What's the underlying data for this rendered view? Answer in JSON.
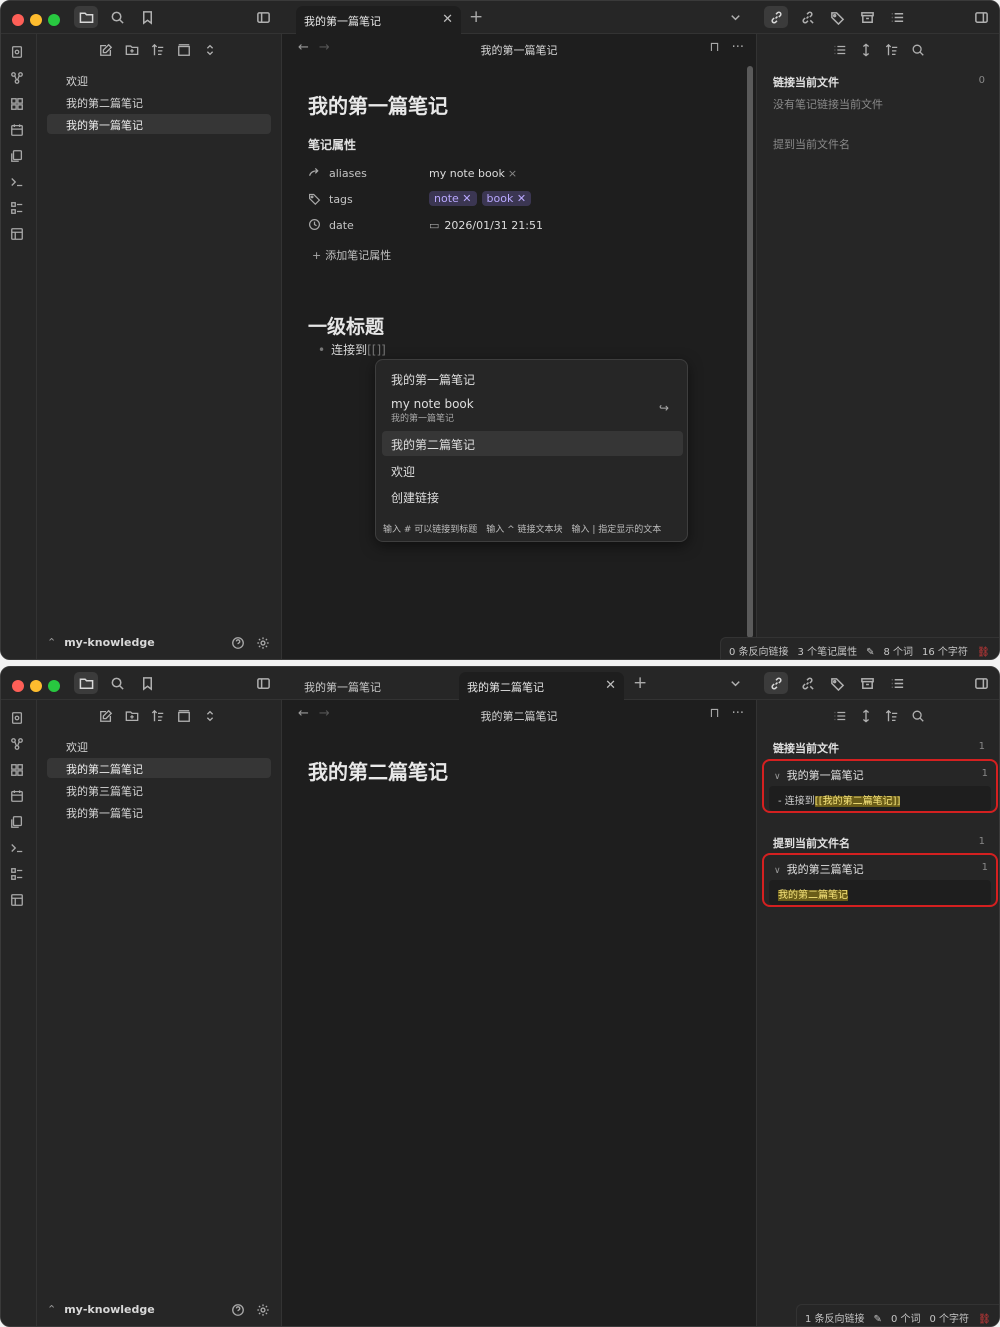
{
  "window1": {
    "tabs": [
      {
        "label": "我的第一篇笔记",
        "active": true
      }
    ],
    "sidebar": {
      "files": [
        "欢迎",
        "我的第二篇笔记",
        "我的第一篇笔记"
      ],
      "selected_index": 2,
      "vault_name": "my-knowledge"
    },
    "view_title": "我的第一篇笔记",
    "note": {
      "title": "我的第一篇笔记",
      "properties_title": "笔记属性",
      "properties": [
        {
          "key": "aliases",
          "icon": "forward-arrow-icon",
          "value": "my note book"
        },
        {
          "key": "tags",
          "icon": "tags-icon",
          "tags": [
            "note",
            "book"
          ]
        },
        {
          "key": "date",
          "icon": "clock-icon",
          "value": "2026/01/31 21:51"
        }
      ],
      "add_property": "添加笔记属性",
      "heading": "一级标题",
      "bullet_text": "连接到",
      "bullet_brackets": "[[]]"
    },
    "suggest": {
      "items": [
        {
          "label": "我的第一篇笔记"
        },
        {
          "label": "my note book",
          "sub": "我的第一篇笔记",
          "alias": true
        },
        {
          "label": "我的第二篇笔记",
          "selected": true
        },
        {
          "label": "欢迎"
        },
        {
          "label": "创建链接"
        }
      ],
      "footer": [
        "输入 # 可以链接到标题",
        "输入 ^ 链接文本块",
        "输入 | 指定显示的文本"
      ]
    },
    "right_panel": {
      "linked_title": "链接当前文件",
      "linked_count": "0",
      "linked_empty": "没有笔记链接当前文件",
      "mentions_title": "提到当前文件名"
    },
    "status": [
      "0 条反向链接",
      "3 个笔记属性",
      "8 个词",
      "16 个字符"
    ]
  },
  "window2": {
    "tabs": [
      {
        "label": "我的第一篇笔记",
        "active": false
      },
      {
        "label": "我的第二篇笔记",
        "active": true
      }
    ],
    "sidebar": {
      "files": [
        "欢迎",
        "我的第二篇笔记",
        "我的第三篇笔记",
        "我的第一篇笔记"
      ],
      "selected_index": 1,
      "vault_name": "my-knowledge"
    },
    "view_title": "我的第二篇笔记",
    "note": {
      "title": "我的第二篇笔记"
    },
    "right_panel": {
      "linked_title": "链接当前文件",
      "linked_count": "1",
      "linked_file": "我的第一篇笔记",
      "linked_file_count": "1",
      "linked_snippet_prefix": "- 连接到",
      "linked_snippet_link": "[[我的第二篇笔记]]",
      "mentions_title": "提到当前文件名",
      "mentions_count": "1",
      "mention_file": "我的第三篇笔记",
      "mention_file_count": "1",
      "mention_snippet": "我的第二篇笔记"
    },
    "status": [
      "1 条反向链接",
      "0 个词",
      "0 个字符"
    ]
  },
  "colors": {
    "tag_bg": "#3b3652",
    "tag_text": "#b9a8ff",
    "highlight_box": "#d42020",
    "sync_off": "#e03b3b"
  }
}
